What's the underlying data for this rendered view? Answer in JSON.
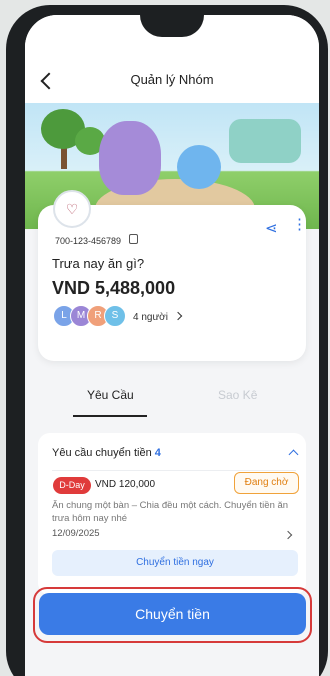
{
  "header": {
    "title": "Quản lý Nhóm"
  },
  "group": {
    "account_number": "700-123-456789",
    "name": "Trưa nay ăn gì?",
    "balance": "VND 5,488,000",
    "member_count": "4 người"
  },
  "tabs": [
    {
      "label": "Yêu Cầu",
      "active": true
    },
    {
      "label": "Sao Kê",
      "active": false
    }
  ],
  "requests": {
    "title": "Yêu cầu chuyển tiền",
    "count": "4",
    "item": {
      "badge": "D-Day",
      "amount": "VND 120,000",
      "status": "Đang chờ",
      "description": "Ăn chung một bàn – Chia đều một cách. Chuyển tiền ăn trưa hôm nay nhé",
      "date": "12/09/2025"
    },
    "action_label": "Chuyển tiền ngay"
  },
  "primary_button": {
    "label": "Chuyển tiền"
  },
  "colors": {
    "accent": "#3a7be6",
    "danger": "#e03b3b",
    "pending": "#f0a23a",
    "highlight": "#d63a3a"
  }
}
